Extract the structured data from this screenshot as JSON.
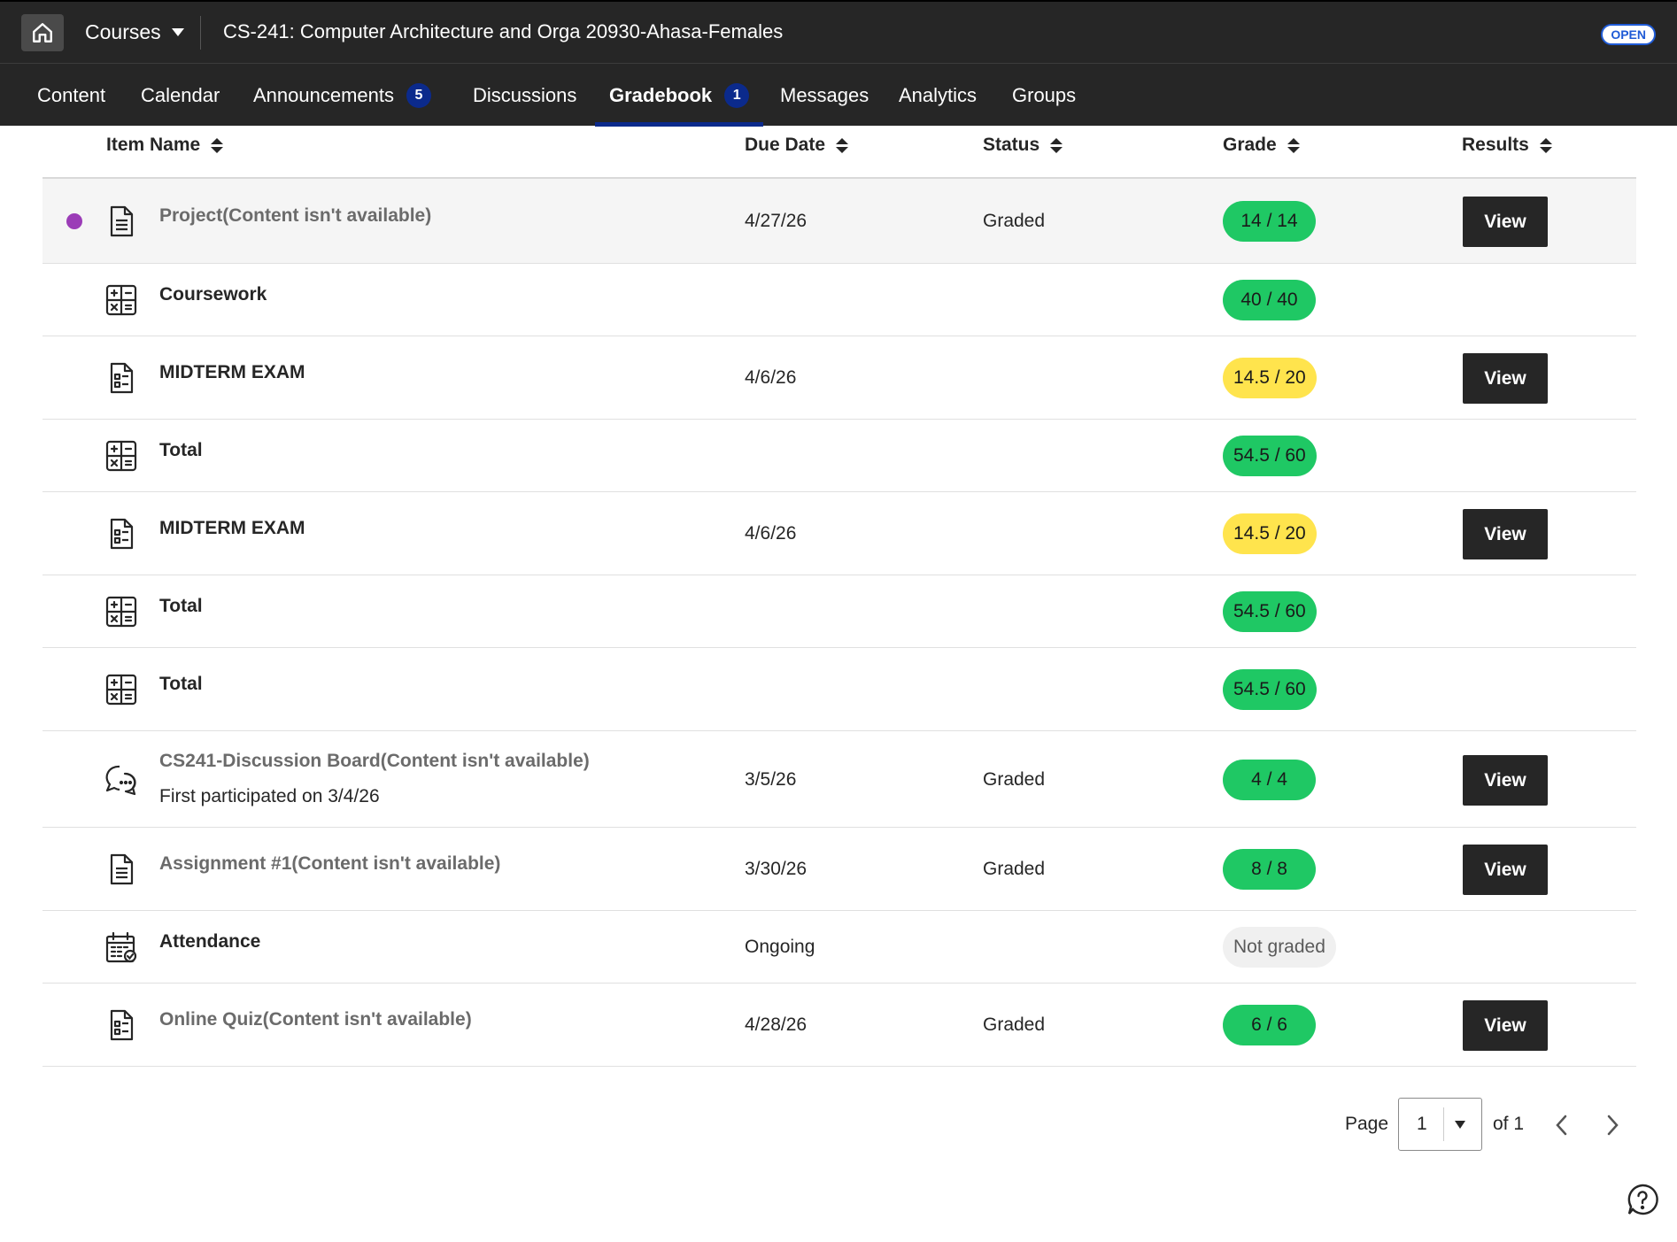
{
  "header": {
    "courses_label": "Courses",
    "course_title": "CS-241: Computer Architecture and Orga 20930-Ahasa-Females",
    "open_badge": "OPEN"
  },
  "tabs": [
    {
      "label": "Content",
      "badge": ""
    },
    {
      "label": "Calendar",
      "badge": ""
    },
    {
      "label": "Announcements",
      "badge": "5"
    },
    {
      "label": "Discussions",
      "badge": ""
    },
    {
      "label": "Gradebook",
      "badge": "1",
      "active": true
    },
    {
      "label": "Messages",
      "badge": ""
    },
    {
      "label": "Analytics",
      "badge": ""
    },
    {
      "label": "Groups",
      "badge": ""
    }
  ],
  "columns": {
    "item_name": "Item Name",
    "due_date": "Due Date",
    "status": "Status",
    "grade": "Grade",
    "results": "Results"
  },
  "rows": [
    {
      "name": "Project(Content isn't available)",
      "sub": "",
      "due": "4/27/26",
      "status": "Graded",
      "grade": "14 / 14",
      "grade_color": "green",
      "view": "View",
      "icon": "document-icon",
      "new": true
    },
    {
      "name": "Coursework",
      "sub": "",
      "due": "",
      "status": "",
      "grade": "40 / 40",
      "grade_color": "green",
      "view": "",
      "icon": "calculator-icon"
    },
    {
      "name": "MIDTERM EXAM",
      "sub": "",
      "due": "4/6/26",
      "status": "",
      "grade": "14.5 / 20",
      "grade_color": "yellow",
      "view": "View",
      "icon": "test-icon"
    },
    {
      "name": "Total",
      "sub": "",
      "due": "",
      "status": "",
      "grade": "54.5 / 60",
      "grade_color": "green",
      "view": "",
      "icon": "calculator-icon"
    },
    {
      "name": "MIDTERM EXAM",
      "sub": "",
      "due": "4/6/26",
      "status": "",
      "grade": "14.5 / 20",
      "grade_color": "yellow",
      "view": "View",
      "icon": "test-icon"
    },
    {
      "name": "Total",
      "sub": "",
      "due": "",
      "status": "",
      "grade": "54.5 / 60",
      "grade_color": "green",
      "view": "",
      "icon": "calculator-icon"
    },
    {
      "name": "Total",
      "sub": "",
      "due": "",
      "status": "",
      "grade": "54.5 / 60",
      "grade_color": "green",
      "view": "",
      "icon": "calculator-icon"
    },
    {
      "name": "CS241-Discussion Board(Content isn't available)",
      "sub": "First participated on 3/4/26",
      "due": "3/5/26",
      "status": "Graded",
      "grade": "4 / 4",
      "grade_color": "green",
      "view": "View",
      "icon": "discussion-icon"
    },
    {
      "name": "Assignment #1(Content isn't available)",
      "sub": "",
      "due": "3/30/26",
      "status": "Graded",
      "grade": "8 / 8",
      "grade_color": "green",
      "view": "View",
      "icon": "document-icon"
    },
    {
      "name": "Attendance",
      "sub": "",
      "due": "Ongoing",
      "status": "",
      "grade": "Not graded",
      "grade_color": "gray",
      "view": "",
      "icon": "attendance-calendar-icon"
    },
    {
      "name": "Online Quiz(Content isn't available)",
      "sub": "",
      "due": "4/28/26",
      "status": "Graded",
      "grade": "6 / 6",
      "grade_color": "green",
      "view": "View",
      "icon": "test-icon"
    }
  ],
  "pager": {
    "page_label": "Page",
    "current": "1",
    "of_label": "of 1"
  },
  "colors": {
    "grade_green": "#1fc864",
    "grade_yellow": "#ffe44d",
    "new_dot": "#9b3cb7",
    "badge_blue": "#0b2a8c",
    "bar_dark": "#262626"
  }
}
